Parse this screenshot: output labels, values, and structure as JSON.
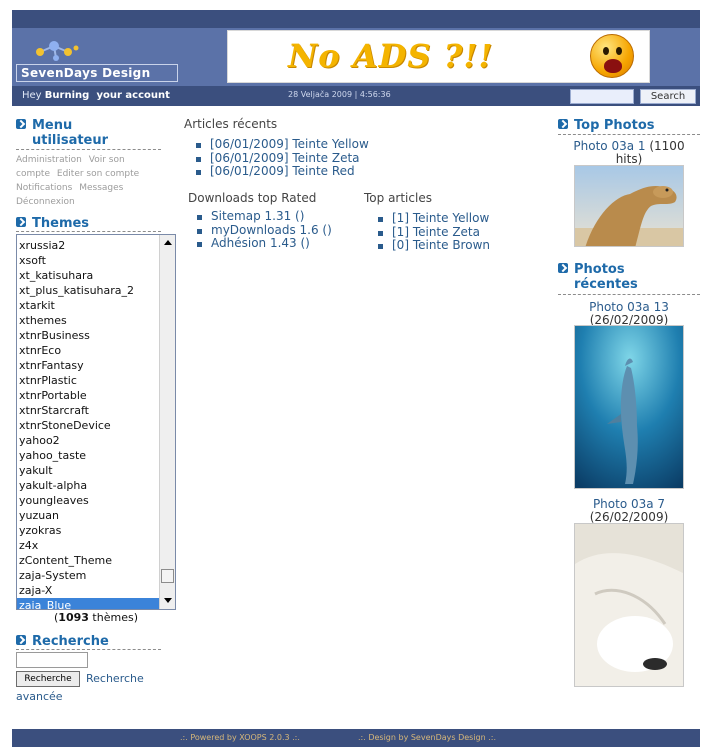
{
  "header": {
    "logo_word1": "SevenDays",
    "logo_word2": "Design",
    "banner_text": "No ADS ?!!"
  },
  "userbar": {
    "greeting_prefix": "Hey",
    "username": "Burning",
    "account_link": "your account",
    "datetime": "28 Veljača 2009 | 4:56:36",
    "search_button": "Search"
  },
  "user_menu": {
    "title": "Menu utilisateur",
    "items": [
      "Administration",
      "Voir son compte",
      "Editer son compte",
      "Notifications",
      "Messages",
      "Déconnexion"
    ]
  },
  "themes": {
    "title": "Themes",
    "items": [
      "xrussia2",
      "xsoft",
      "xt_katisuhara",
      "xt_plus_katisuhara_2",
      "xtarkit",
      "xthemes",
      "xtnrBusiness",
      "xtnrEco",
      "xtnrFantasy",
      "xtnrPlastic",
      "xtnrPortable",
      "xtnrStarcraft",
      "xtnrStoneDevice",
      "yahoo2",
      "yahoo_taste",
      "yakult",
      "yakult-alpha",
      "youngleaves",
      "yuzuan",
      "yzokras",
      "z4x",
      "zContent_Theme",
      "zaja-System",
      "zaja-X",
      "zaja_Blue"
    ],
    "selected": "zaja_Blue",
    "count_number": "1093",
    "count_suffix": "thèmes"
  },
  "search_block": {
    "title": "Recherche",
    "button": "Recherche",
    "advanced_link_1": "Recherche",
    "advanced_link_2": "avancée"
  },
  "center": {
    "recent_articles_title": "Articles récents",
    "recent_articles": [
      "[06/01/2009] Teinte Yellow",
      "[06/01/2009] Teinte Zeta",
      "[06/01/2009] Teinte Red"
    ],
    "downloads_title": "Downloads top Rated",
    "downloads": [
      "Sitemap 1.31 ()",
      "myDownloads 1.6 ()",
      "Adhésion 1.43 ()"
    ],
    "top_articles_title": "Top articles",
    "top_articles": [
      "[1] Teinte Yellow",
      "[1] Teinte Zeta",
      "[0] Teinte Brown"
    ]
  },
  "right": {
    "top_photos_title": "Top Photos",
    "top_photo": {
      "title": "Photo 03a 1",
      "meta": "(1100 hits)"
    },
    "recent_photos_title": "Photos récentes",
    "recent_photos": [
      {
        "title": "Photo 03a 13",
        "meta": "(26/02/2009)"
      },
      {
        "title": "Photo 03a 7",
        "meta": "(26/02/2009)"
      }
    ]
  },
  "footer": {
    "powered": ".:. Powered by XOOPS 2.0.3 .:.",
    "design": ".:. Design by SevenDays Design .:."
  },
  "colors": {
    "header_dark": "#3b4f7e",
    "header_mid": "#5b72a8",
    "link_blue": "#2a5b8c",
    "title_blue": "#1e6aa9",
    "selected_row": "#3b83d9"
  }
}
